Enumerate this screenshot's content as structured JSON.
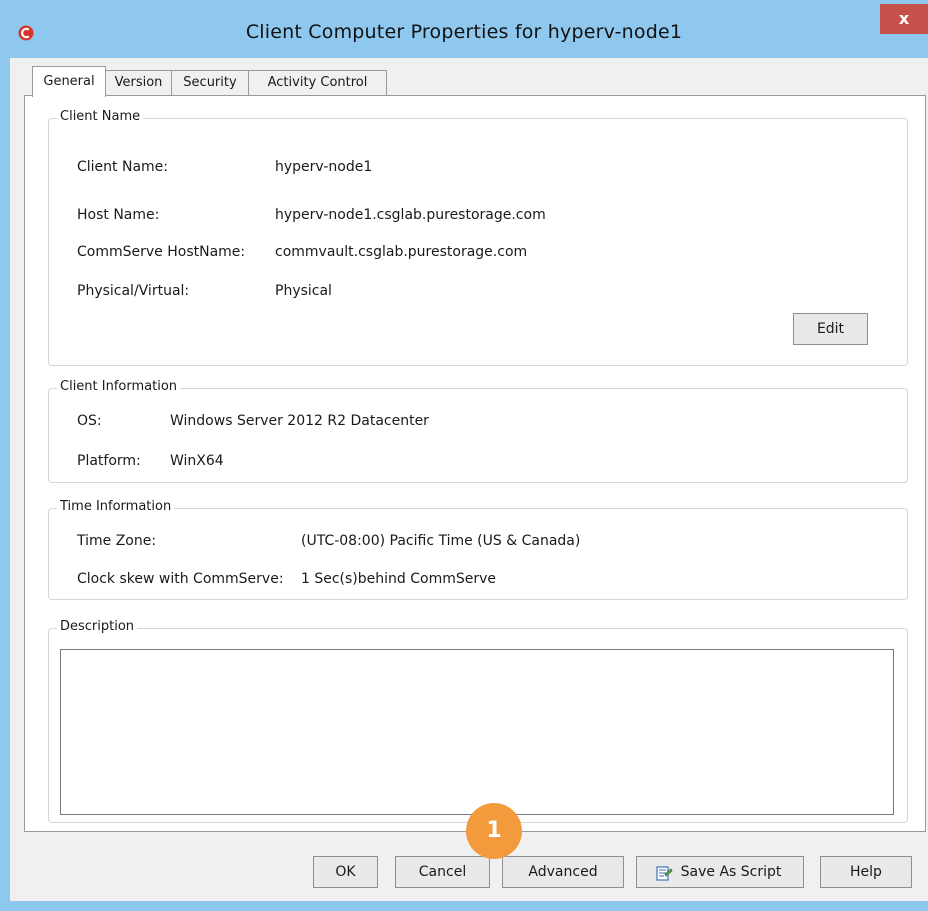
{
  "window": {
    "title": "Client Computer Properties for hyperv-node1",
    "close_label": "x"
  },
  "tabs": [
    "General",
    "Version",
    "Security",
    "Activity Control"
  ],
  "active_tab": "General",
  "client_name_group": {
    "title": "Client Name",
    "rows": [
      {
        "label": "Client Name:",
        "value": "hyperv-node1"
      },
      {
        "label": "Host Name:",
        "value": "hyperv-node1.csglab.purestorage.com"
      },
      {
        "label": "CommServe HostName:",
        "value": "commvault.csglab.purestorage.com"
      },
      {
        "label": "Physical/Virtual:",
        "value": "Physical"
      }
    ],
    "edit_label": "Edit"
  },
  "client_info_group": {
    "title": "Client Information",
    "rows": [
      {
        "label": "OS:",
        "value": "Windows Server 2012 R2 Datacenter"
      },
      {
        "label": "Platform:",
        "value": "WinX64"
      }
    ]
  },
  "time_info_group": {
    "title": "Time Information",
    "rows": [
      {
        "label": "Time Zone:",
        "value": "(UTC-08:00) Pacific Time (US & Canada)"
      },
      {
        "label": "Clock skew with CommServe:",
        "value": "1 Sec(s)behind CommServe"
      }
    ]
  },
  "description_group": {
    "title": "Description",
    "value": ""
  },
  "buttons": {
    "ok": "OK",
    "cancel": "Cancel",
    "advanced": "Advanced",
    "save_as_script": "Save As Script",
    "help": "Help"
  },
  "callout": {
    "number": "1",
    "color": "#f29a3c"
  },
  "colors": {
    "window_frame": "#8ec8ee",
    "close_button": "#c7524c",
    "dialog_bg": "#f0f0f0"
  }
}
